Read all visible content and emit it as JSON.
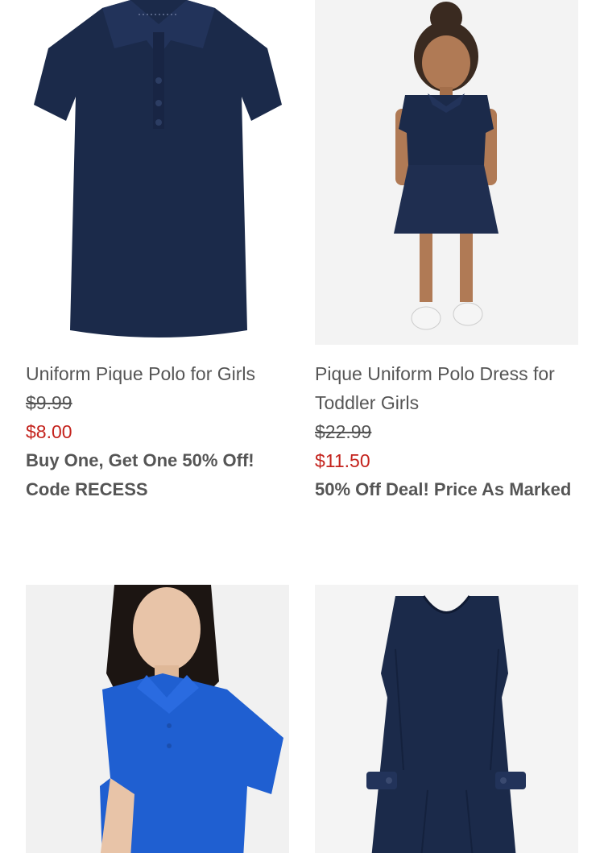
{
  "products": [
    {
      "title": "Uniform Pique Polo for Girls",
      "image_label": "navy-girls-polo-shirt",
      "original_price": "$9.99",
      "sale_price": "$8.00",
      "promo": "Buy One, Get One 50% Off! Code RECESS"
    },
    {
      "title": "Pique Uniform Polo Dress for Toddler Girls",
      "image_label": "toddler-girl-in-navy-polo-dress",
      "original_price": "$22.99",
      "sale_price": "$11.50",
      "promo": "50% Off Deal! Price As Marked"
    },
    {
      "image_label": "woman-in-blue-polo-shirt"
    },
    {
      "image_label": "navy-sleeveless-jumper-dress"
    }
  ],
  "colors": {
    "navy": "#1b2a4a",
    "royal_blue": "#1f5fd1",
    "sale_red": "#c4231d",
    "text_gray": "#555555",
    "image_bg": "#f3f3f3"
  }
}
